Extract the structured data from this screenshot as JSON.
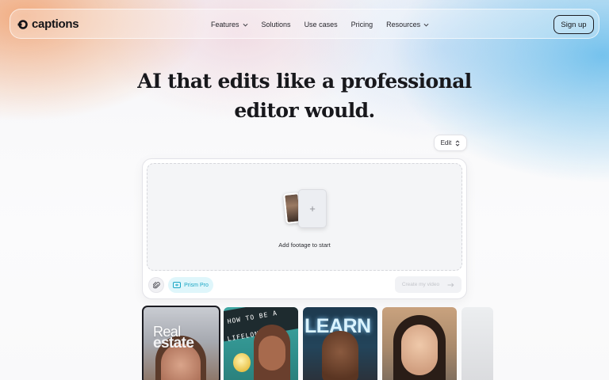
{
  "nav": {
    "logo": "captions",
    "menu": [
      {
        "label": "Features",
        "has_dropdown": true
      },
      {
        "label": "Solutions",
        "has_dropdown": false
      },
      {
        "label": "Use cases",
        "has_dropdown": false
      },
      {
        "label": "Pricing",
        "has_dropdown": false
      },
      {
        "label": "Resources",
        "has_dropdown": true
      }
    ],
    "signup": "Sign up"
  },
  "hero": {
    "line1": "AI that edits like a professional",
    "line2": "editor would."
  },
  "mode_select": {
    "value": "Edit"
  },
  "editor": {
    "dropzone_label": "Add footage to start",
    "attach_icon": "paperclip-icon",
    "prism_label": "Prism Pro",
    "create_label": "Create my video"
  },
  "templates": [
    {
      "text_top": "Real",
      "text_bottom": "estate"
    },
    {
      "text_top": "HOW TO BE A",
      "text_bottom": "LIFELONG"
    },
    {
      "text_top": "LEARN"
    },
    {},
    {}
  ],
  "colors": {
    "accent_cyan": "#1aa6c4",
    "prism_bg": "#dff6fb",
    "text_dark": "#18181c"
  }
}
